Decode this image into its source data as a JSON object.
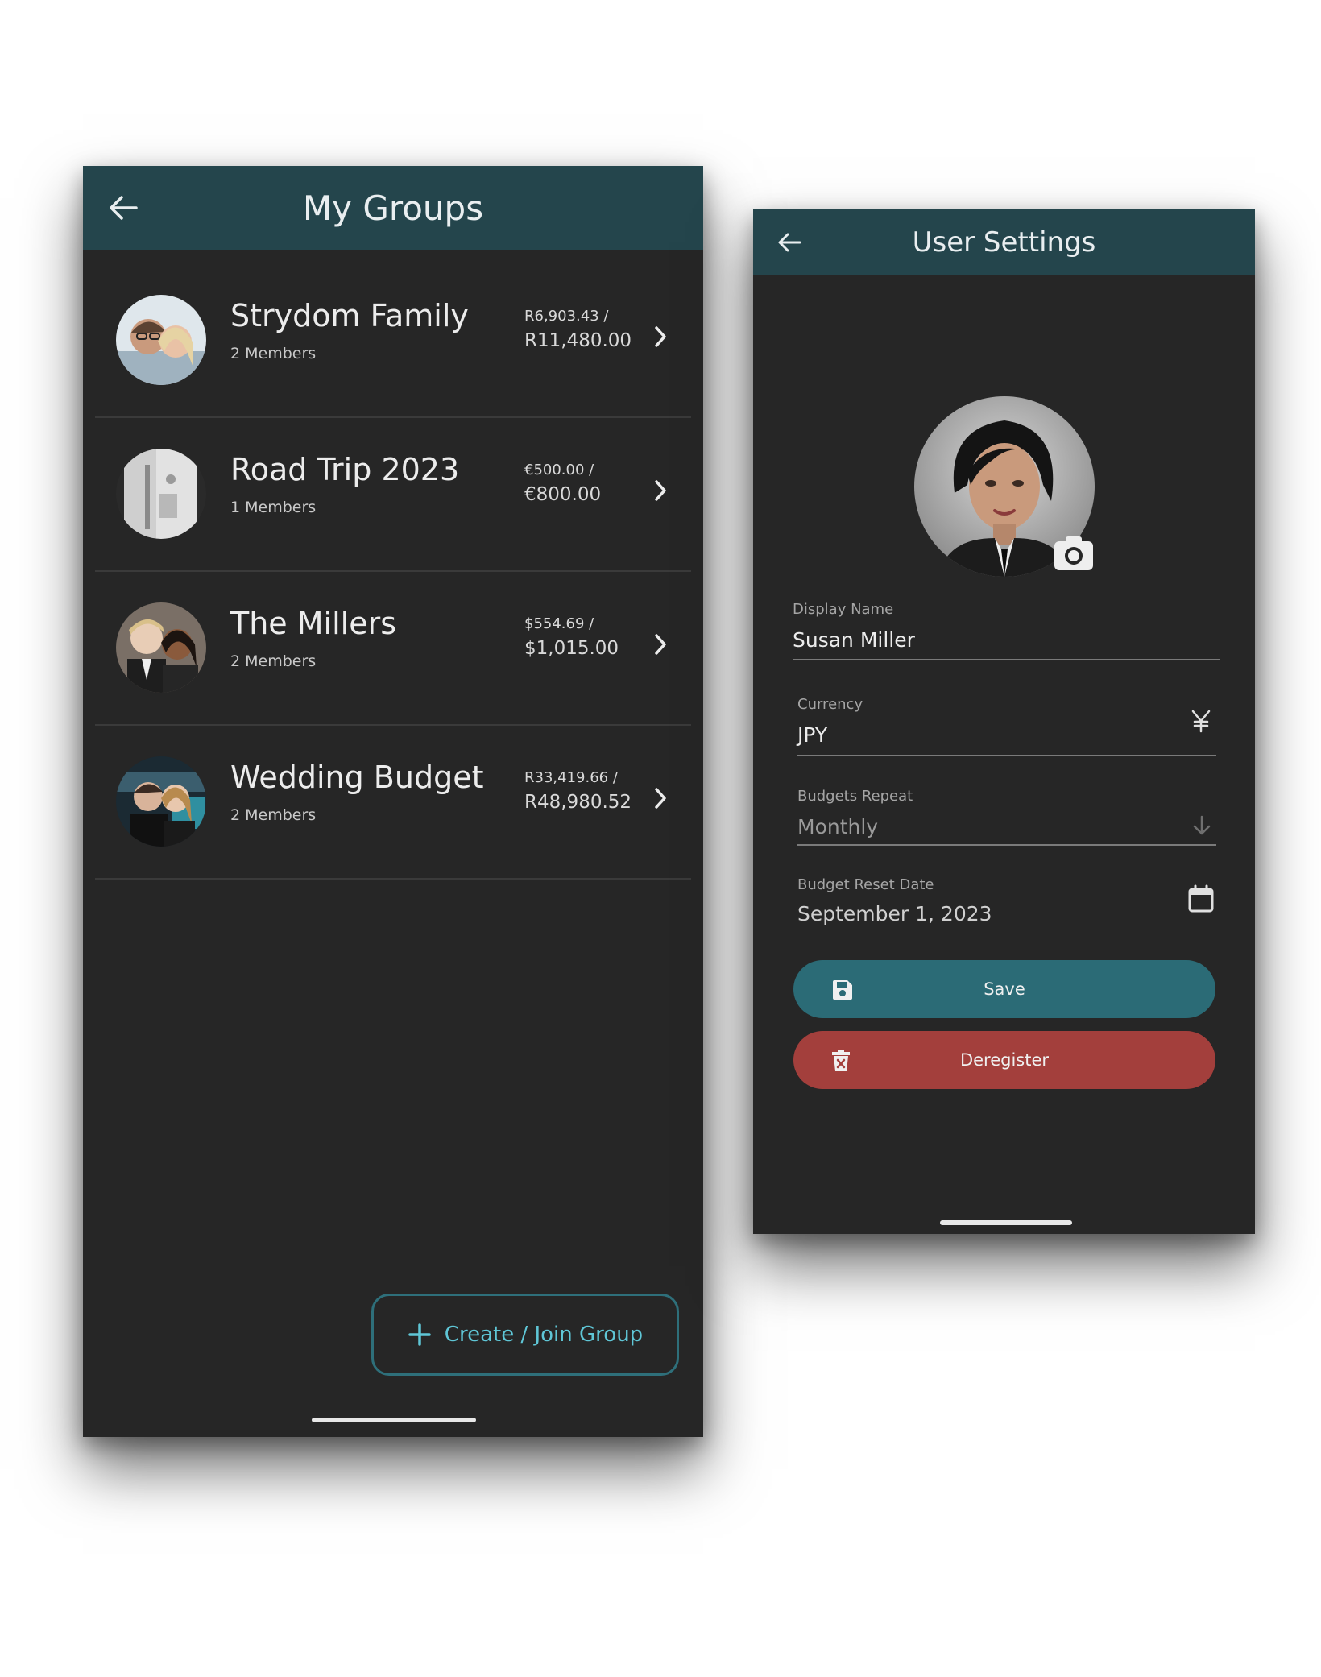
{
  "groups_screen": {
    "title": "My Groups",
    "groups": [
      {
        "name": "Strydom Family",
        "members": "2 Members",
        "spent": "R6,903.43 /",
        "total": "R11,480.00"
      },
      {
        "name": "Road Trip 2023",
        "members": "1 Members",
        "spent": "€500.00 /",
        "total": "€800.00"
      },
      {
        "name": "The Millers",
        "members": "2 Members",
        "spent": "$554.69 /",
        "total": "$1,015.00"
      },
      {
        "name": "Wedding Budget",
        "members": "2 Members",
        "spent": "R33,419.66 /",
        "total": "R48,980.52"
      }
    ],
    "create_join_label": "Create / Join Group"
  },
  "settings_screen": {
    "title": "User Settings",
    "display_name": {
      "label": "Display Name",
      "value": "Susan Miller"
    },
    "currency": {
      "label": "Currency",
      "value": "JPY",
      "icon": "yen-icon"
    },
    "budgets_repeat": {
      "label": "Budgets Repeat",
      "value": "Monthly",
      "icon": "arrow-down-icon"
    },
    "budget_reset_date": {
      "label": "Budget Reset Date",
      "value": "September 1, 2023",
      "icon": "calendar-icon"
    },
    "save_label": "Save",
    "deregister_label": "Deregister"
  },
  "colors": {
    "header": "#24454c",
    "background": "#262626",
    "accent": "#5fc6d6",
    "save": "#2b6b76",
    "deregister": "#a33f3c"
  }
}
